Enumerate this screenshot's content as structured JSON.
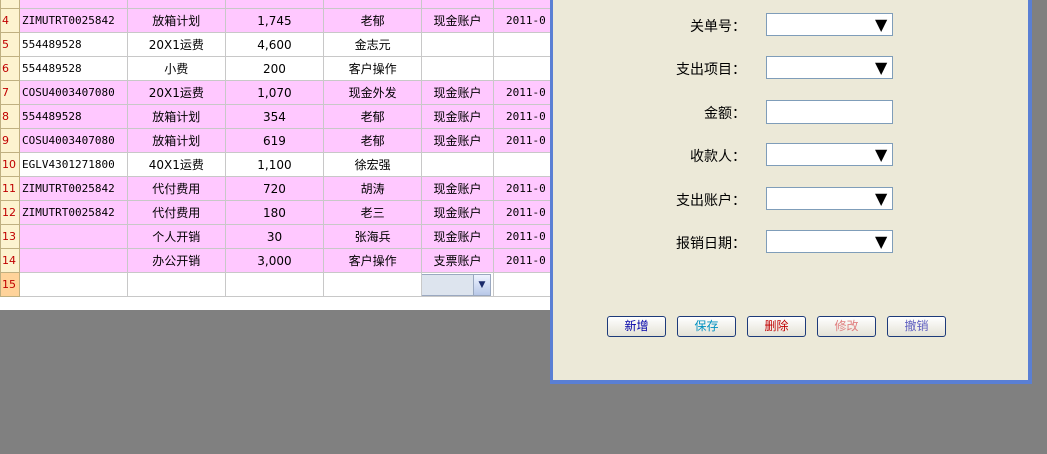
{
  "grid": {
    "rows": [
      {
        "num": "",
        "waybill": "",
        "item": "",
        "amount": "",
        "payee": "",
        "account": "",
        "date": "",
        "pink": true
      },
      {
        "num": "4",
        "waybill": "ZIMUTRT0025842",
        "item": "放箱计划",
        "amount": "1,745",
        "payee": "老郁",
        "account": "现金账户",
        "date": "2011-0",
        "pink": true
      },
      {
        "num": "5",
        "waybill": "554489528",
        "item": "20X1运费",
        "amount": "4,600",
        "payee": "金志元",
        "account": "",
        "date": "",
        "pink": false
      },
      {
        "num": "6",
        "waybill": "554489528",
        "item": "小费",
        "amount": "200",
        "payee": "客户操作",
        "account": "",
        "date": "",
        "pink": false
      },
      {
        "num": "7",
        "waybill": "COSU4003407080",
        "item": "20X1运费",
        "amount": "1,070",
        "payee": "现金外发",
        "account": "现金账户",
        "date": "2011-0",
        "pink": true
      },
      {
        "num": "8",
        "waybill": "554489528",
        "item": "放箱计划",
        "amount": "354",
        "payee": "老郁",
        "account": "现金账户",
        "date": "2011-0",
        "pink": true
      },
      {
        "num": "9",
        "waybill": "COSU4003407080",
        "item": "放箱计划",
        "amount": "619",
        "payee": "老郁",
        "account": "现金账户",
        "date": "2011-0",
        "pink": true
      },
      {
        "num": "10",
        "waybill": "EGLV4301271800",
        "item": "40X1运费",
        "amount": "1,100",
        "payee": "徐宏强",
        "account": "",
        "date": "",
        "pink": false
      },
      {
        "num": "11",
        "waybill": "ZIMUTRT0025842",
        "item": "代付费用",
        "amount": "720",
        "payee": "胡涛",
        "account": "现金账户",
        "date": "2011-0",
        "pink": true
      },
      {
        "num": "12",
        "waybill": "ZIMUTRT0025842",
        "item": "代付费用",
        "amount": "180",
        "payee": "老三",
        "account": "现金账户",
        "date": "2011-0",
        "pink": true
      },
      {
        "num": "13",
        "waybill": "",
        "item": "个人开销",
        "amount": "30",
        "payee": "张海兵",
        "account": "现金账户",
        "date": "2011-0",
        "pink": true
      },
      {
        "num": "14",
        "waybill": "",
        "item": "办公开销",
        "amount": "3,000",
        "payee": "客户操作",
        "account": "支票账户",
        "date": "2011-0",
        "pink": true
      },
      {
        "num": "15",
        "waybill": "",
        "item": "",
        "amount": "",
        "payee": "",
        "account": "",
        "date": "",
        "pink": false,
        "current": true
      }
    ]
  },
  "form": {
    "fields": [
      {
        "label": "关单号：",
        "type": "combo",
        "value": ""
      },
      {
        "label": "支出项目：",
        "type": "combo",
        "value": ""
      },
      {
        "label": "金额：",
        "type": "input",
        "value": ""
      },
      {
        "label": "收款人：",
        "type": "combo",
        "value": ""
      },
      {
        "label": "支出账户：",
        "type": "combo",
        "value": ""
      },
      {
        "label": "报销日期：",
        "type": "combo",
        "value": ""
      }
    ],
    "buttons": [
      {
        "label": "新增",
        "color": "#0000a8"
      },
      {
        "label": "保存",
        "color": "#0090c0"
      },
      {
        "label": "删除",
        "color": "#c00000"
      },
      {
        "label": "修改",
        "color": "#e08080"
      },
      {
        "label": "撤销",
        "color": "#6060c0"
      }
    ]
  },
  "icons": {
    "dropdown": "chevron-down-icon"
  }
}
